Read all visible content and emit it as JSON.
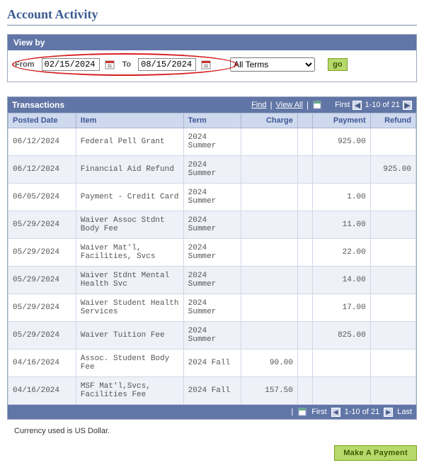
{
  "pageTitle": "Account Activity",
  "viewBy": {
    "header": "View by",
    "fromLabel": "From",
    "fromValue": "02/15/2024",
    "toLabel": "To",
    "toValue": "08/15/2024",
    "termSelected": "All Terms",
    "goLabel": "go"
  },
  "transactions": {
    "title": "Transactions",
    "findLabel": "Find",
    "viewAllLabel": "View All",
    "firstLabel": "First",
    "lastLabel": "Last",
    "rangeTop": "1-10 of 21",
    "rangeBottom": "1-10 of 21",
    "columns": {
      "postedDate": "Posted Date",
      "item": "Item",
      "term": "Term",
      "charge": "Charge",
      "payment": "Payment",
      "refund": "Refund"
    },
    "rows": [
      {
        "date": "06/12/2024",
        "item": "Federal Pell Grant",
        "term": "2024 Summer",
        "charge": "",
        "payment": "925.00",
        "refund": ""
      },
      {
        "date": "06/12/2024",
        "item": "Financial Aid Refund",
        "term": "2024 Summer",
        "charge": "",
        "payment": "",
        "refund": "925.00"
      },
      {
        "date": "06/05/2024",
        "item": "Payment - Credit Card",
        "term": "2024 Summer",
        "charge": "",
        "payment": "1.00",
        "refund": ""
      },
      {
        "date": "05/29/2024",
        "item": "Waiver Assoc Stdnt Body Fee",
        "term": "2024 Summer",
        "charge": "",
        "payment": "11.00",
        "refund": ""
      },
      {
        "date": "05/29/2024",
        "item": "Waiver Mat'l, Facilities, Svcs",
        "term": "2024 Summer",
        "charge": "",
        "payment": "22.00",
        "refund": ""
      },
      {
        "date": "05/29/2024",
        "item": "Waiver Stdnt Mental Health Svc",
        "term": "2024 Summer",
        "charge": "",
        "payment": "14.00",
        "refund": ""
      },
      {
        "date": "05/29/2024",
        "item": "Waiver Student Health Services",
        "term": "2024 Summer",
        "charge": "",
        "payment": "17.00",
        "refund": ""
      },
      {
        "date": "05/29/2024",
        "item": "Waiver Tuition Fee",
        "term": "2024 Summer",
        "charge": "",
        "payment": "825.00",
        "refund": ""
      },
      {
        "date": "04/16/2024",
        "item": "Assoc. Student Body Fee",
        "term": "2024 Fall",
        "charge": "90.00",
        "payment": "",
        "refund": ""
      },
      {
        "date": "04/16/2024",
        "item": "MSF Mat'l,Svcs, Facilities Fee",
        "term": "2024 Fall",
        "charge": "157.50",
        "payment": "",
        "refund": ""
      }
    ]
  },
  "currencyNote": "Currency used is US Dollar.",
  "makePaymentLabel": "Make A Payment"
}
